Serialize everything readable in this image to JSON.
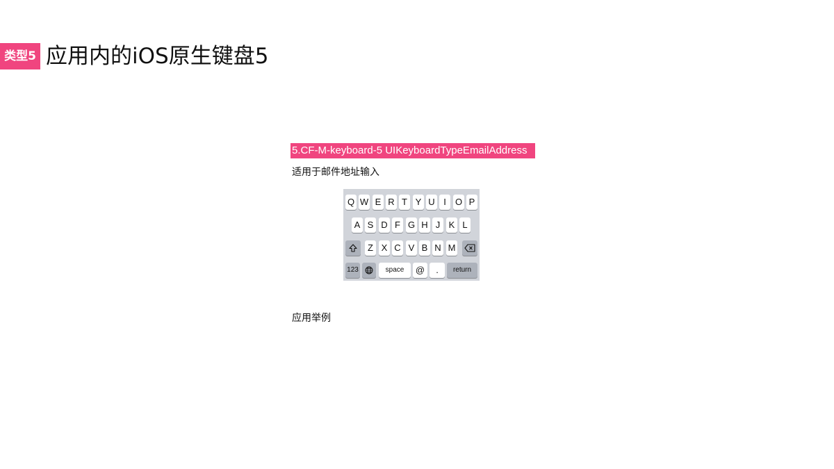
{
  "header": {
    "badge": "类型5",
    "title": "应用内的iOS原生键盘5"
  },
  "section": {
    "tag": "5.CF-M-keyboard-5 UIKeyboardTypeEmailAddress",
    "description": "适用于邮件地址输入",
    "example_label": "应用举例"
  },
  "keyboard": {
    "row1": [
      "Q",
      "W",
      "E",
      "R",
      "T",
      "Y",
      "U",
      "I",
      "O",
      "P"
    ],
    "row2": [
      "A",
      "S",
      "D",
      "F",
      "G",
      "H",
      "J",
      "K",
      "L"
    ],
    "row3": [
      "Z",
      "X",
      "C",
      "V",
      "B",
      "N",
      "M"
    ],
    "numbers_label": "123",
    "space_label": "space",
    "at_label": "@",
    "dot_label": ".",
    "return_label": "return",
    "shift_icon": "shift-arrow-icon",
    "delete_icon": "backspace-icon",
    "globe_icon": "globe-icon"
  },
  "colors": {
    "accent": "#f0457f",
    "keyboard_bg": "#d1d4da",
    "key_light": "#ffffff",
    "key_dark": "#adb2bb"
  }
}
